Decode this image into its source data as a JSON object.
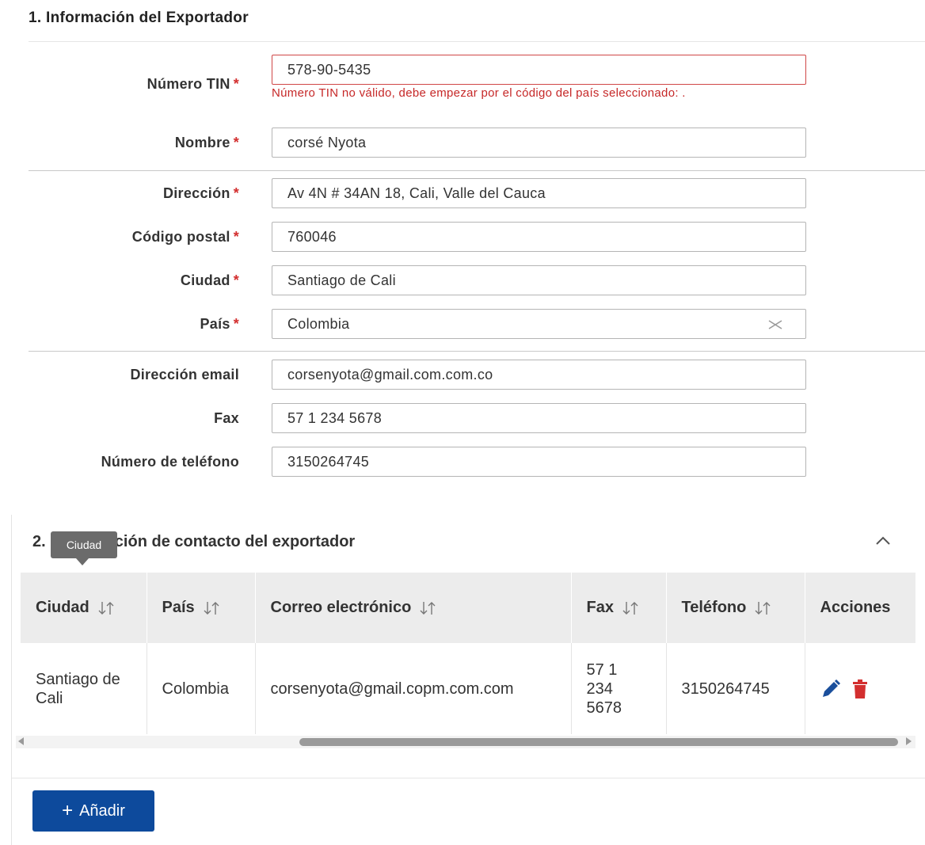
{
  "section1": {
    "title": "1. Información del Exportador",
    "fields": {
      "tin": {
        "label": "Número TIN",
        "required": "*",
        "value": "578-90-5435",
        "error": "Número TIN no válido, debe empezar por el código del país seleccionado: ."
      },
      "nombre": {
        "label": "Nombre",
        "required": "*",
        "value": "corsé Nyota"
      },
      "direccion": {
        "label": "Dirección",
        "required": "*",
        "value": "Av 4N # 34AN 18, Cali, Valle del Cauca"
      },
      "codigo_postal": {
        "label": "Código postal",
        "required": "*",
        "value": "760046"
      },
      "ciudad": {
        "label": "Ciudad",
        "required": "*",
        "value": "Santiago de Cali"
      },
      "pais": {
        "label": "País",
        "required": "*",
        "value": "Colombia",
        "clear_icon": "close-icon"
      },
      "email": {
        "label": "Dirección email",
        "value": "corsenyota@gmail.com.com.co"
      },
      "fax": {
        "label": "Fax",
        "value": "57 1 234 5678"
      },
      "telefono": {
        "label": "Número de teléfono",
        "value": "3150264745"
      }
    }
  },
  "section2": {
    "title_prefix": "2.",
    "title_rest": "ación de contacto del exportador",
    "tooltip": "Ciudad",
    "columns": [
      "Ciudad",
      "País",
      "Correo electrónico",
      "Fax",
      "Teléfono",
      "Acciones"
    ],
    "rows": [
      {
        "ciudad": "Santiago de Cali",
        "pais": "Colombia",
        "email": "corsenyota@gmail.copm.com.com",
        "fax": "57 1 234 5678",
        "telefono": "3150264745"
      }
    ],
    "add_button": "Añadir"
  },
  "colors": {
    "primary": "#0d4a9c",
    "error": "#d32f2f",
    "edit_icon": "#1a4f9c",
    "delete_icon": "#d32f2f"
  }
}
